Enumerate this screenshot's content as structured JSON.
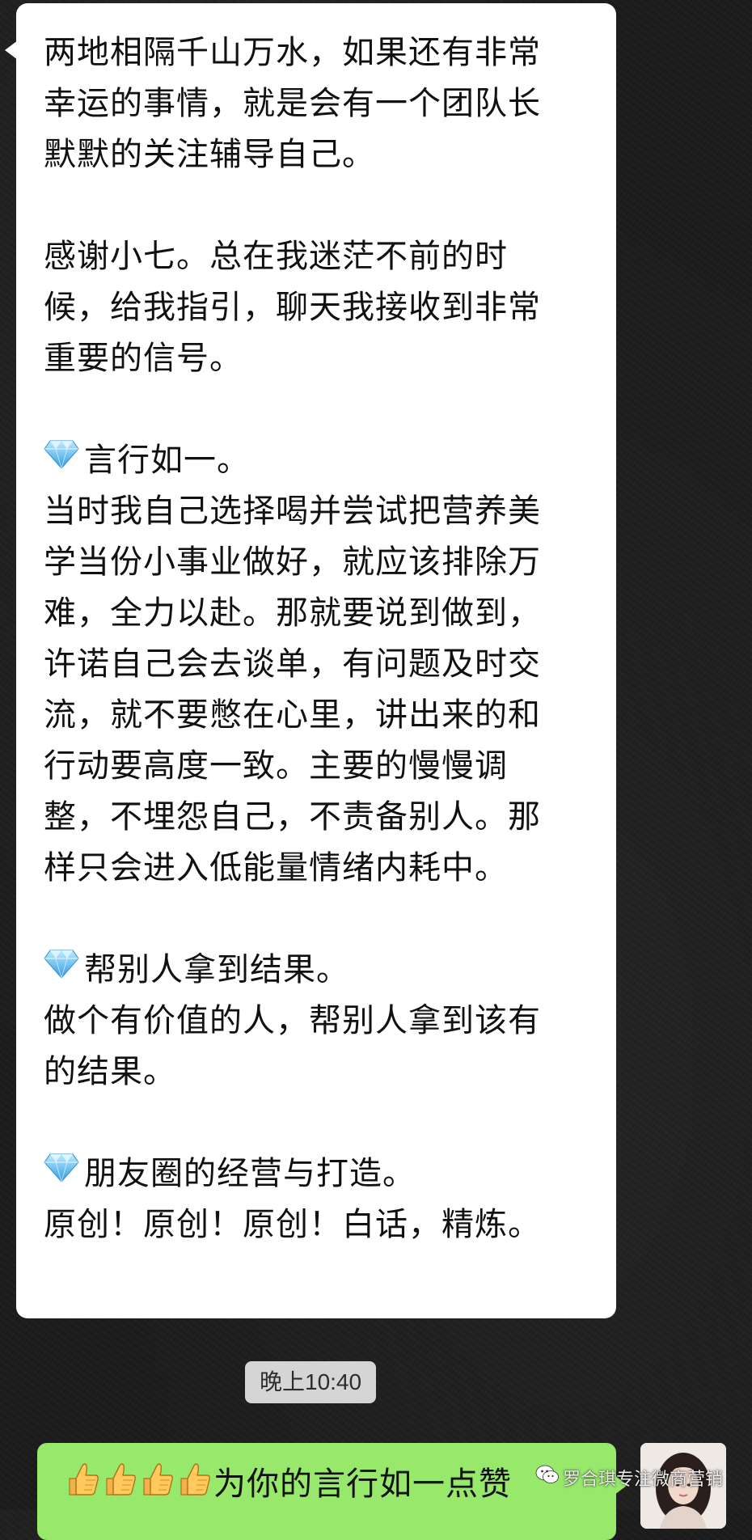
{
  "incoming_message": {
    "blocks": [
      {
        "lines": [
          {
            "text": "两地相隔千山万水，如果还有非常"
          },
          {
            "text": "幸运的事情，就是会有一个团队长"
          },
          {
            "text": "默默的关注辅导自己。"
          }
        ]
      },
      {
        "lines": [
          {
            "text": "感谢小七。总在我迷茫不前的时"
          },
          {
            "text": "候，给我指引，聊天我接收到非常"
          },
          {
            "text": "重要的信号。"
          }
        ]
      },
      {
        "lines": [
          {
            "icon": "gem-icon",
            "text": "言行如一。"
          },
          {
            "text": "当时我自己选择喝并尝试把营养美"
          },
          {
            "text": "学当份小事业做好，就应该排除万"
          },
          {
            "text": "难，全力以赴。那就要说到做到，"
          },
          {
            "text": "许诺自己会去谈单，有问题及时交"
          },
          {
            "text": "流，就不要憋在心里，讲出来的和"
          },
          {
            "text": "行动要高度一致。主要的慢慢调"
          },
          {
            "text": "整，不埋怨自己，不责备别人。那"
          },
          {
            "text": "样只会进入低能量情绪内耗中。"
          }
        ]
      },
      {
        "lines": [
          {
            "icon": "gem-icon",
            "text": "帮别人拿到结果。"
          },
          {
            "text": "做个有价值的人，帮别人拿到该有"
          },
          {
            "text": "的结果。"
          }
        ]
      },
      {
        "lines": [
          {
            "icon": "gem-icon",
            "text": "朋友圈的经营与打造。"
          },
          {
            "text": "原创！原创！原创！白话，精炼。"
          }
        ]
      }
    ]
  },
  "timestamp": {
    "text": "晚上10:40"
  },
  "outgoing_message": {
    "emoji": [
      "thumbs-up-icon",
      "thumbs-up-icon",
      "thumbs-up-icon",
      "thumbs-up-icon"
    ],
    "text": "为你的言行如一点赞"
  },
  "watermark": {
    "text": "罗合琪专注微商营销",
    "icon": "wechat-official-account-icon"
  },
  "colors": {
    "background": "#1b1b1b",
    "incoming_bubble": "#ffffff",
    "outgoing_bubble": "#97e86b",
    "timestamp_pill": "#d5d5d5"
  }
}
